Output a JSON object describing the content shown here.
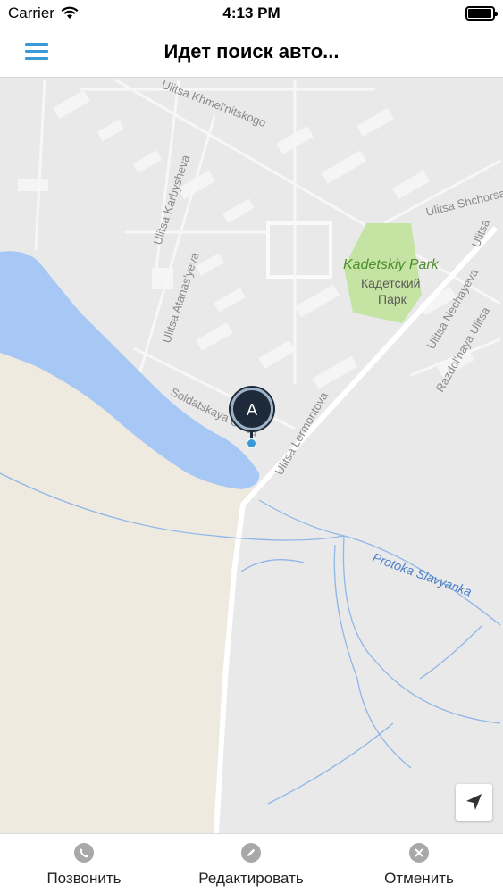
{
  "status_bar": {
    "carrier": "Carrier",
    "time": "4:13 PM",
    "battery_level": 0.95
  },
  "nav": {
    "title": "Идет поиск авто...",
    "menu_icon": "hamburger-menu-icon",
    "accent_color": "#3a9ad9"
  },
  "map": {
    "streets": {
      "khmelnitskogo": "Ulitsa Khmel'nitskogo",
      "karbysheva": "Ulitsa Karbysheva",
      "atanasyeva": "Ulitsa Atanas'yeva",
      "soldatskaya": "Soldatskaya Ulitsa",
      "lermontova": "Ulitsa Lermontova",
      "shchorsa": "Ulitsa Shchorsa",
      "nechayeva": "Ulitsa Nechayeva",
      "razdolnaya": "Razdol'naya Ulitsa",
      "ulitsa_edge": "Ulitsa"
    },
    "park": {
      "name_en": "Kadetskiy Park",
      "name_ru_line1": "Кадетский",
      "name_ru_line2": "Парк"
    },
    "river": "Protoka Slavyanka",
    "pin_label": "A",
    "pin_color": "#1d2a3a",
    "water_color": "#a7c8f5",
    "park_color": "#c5e3a3",
    "land_color": "#eeeae0",
    "locate_icon": "location-arrow-icon"
  },
  "toolbar": {
    "call_label": "Позвонить",
    "edit_label": "Редактировать",
    "cancel_label": "Отменить",
    "call_icon": "phone-icon",
    "edit_icon": "pencil-icon",
    "cancel_icon": "close-icon"
  }
}
